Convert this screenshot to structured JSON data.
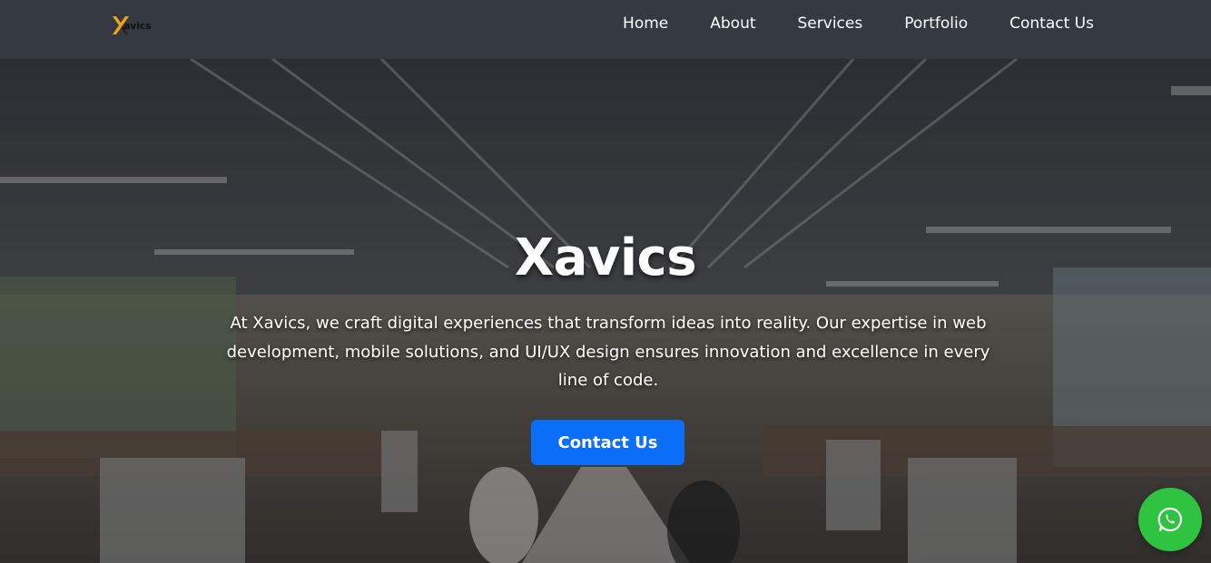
{
  "navbar": {
    "logo_text": "avics",
    "links": [
      "Home",
      "About",
      "Services",
      "Portfolio",
      "Contact Us"
    ]
  },
  "hero": {
    "title": "Xavics",
    "text": "At Xavics, we craft digital experiences that transform ideas into reality. Our expertise in web development, mobile solutions, and UI/UX design ensures innovation and excellence in every line of code.",
    "button_label": "Contact Us"
  },
  "icons": {
    "logo": "x-logo-icon",
    "whatsapp": "whatsapp-icon"
  },
  "colors": {
    "navbar_bg": "#353a42",
    "button_bg": "#0b6ef7",
    "whatsapp_bg": "#2ec441",
    "logo_accent": "#f0a21c"
  }
}
